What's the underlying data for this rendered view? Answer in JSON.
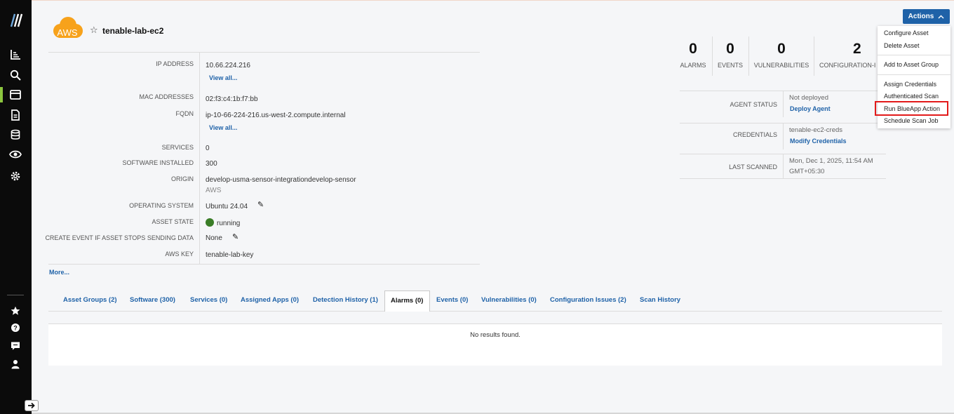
{
  "asset": {
    "badge_text": "AWS",
    "title": "tenable-lab-ec2"
  },
  "details": [
    {
      "label": "IP ADDRESS",
      "value": "10.66.224.216",
      "link": "View all..."
    },
    {
      "label": "MAC ADDRESSES",
      "value": "02:f3:c4:1b:f7:bb"
    },
    {
      "label": "FQDN",
      "value": "ip-10-66-224-216.us-west-2.compute.internal",
      "link": "View all..."
    },
    {
      "label": "SERVICES",
      "value": "0"
    },
    {
      "label": "SOFTWARE INSTALLED",
      "value": "300"
    },
    {
      "label": "ORIGIN",
      "value": "develop-usma-sensor-integrationdevelop-sensor",
      "sub": "AWS"
    },
    {
      "label": "OPERATING SYSTEM",
      "value": "Ubuntu 24.04"
    },
    {
      "label": "ASSET STATE",
      "value": "running"
    },
    {
      "label": "CREATE EVENT IF ASSET STOPS SENDING DATA",
      "value": "None"
    },
    {
      "label": "AWS KEY",
      "value": "tenable-lab-key"
    }
  ],
  "more_link": "More...",
  "stats": [
    {
      "num": "0",
      "label": "ALARMS"
    },
    {
      "num": "0",
      "label": "EVENTS"
    },
    {
      "num": "0",
      "label": "VULNERABILITIES"
    },
    {
      "num": "2",
      "label": "CONFIGURATION-I"
    }
  ],
  "info": {
    "agent_status": {
      "label": "AGENT STATUS",
      "value": "Not deployed",
      "link": "Deploy Agent"
    },
    "credentials": {
      "label": "CREDENTIALS",
      "value": "tenable-ec2-creds",
      "link": "Modify Credentials"
    },
    "last_scanned": {
      "label": "LAST SCANNED",
      "line1": "Mon, Dec 1, 2025, 11:54 AM",
      "line2": "GMT+05:30"
    }
  },
  "actions": {
    "label": "Actions",
    "items": [
      "Configure Asset",
      "Delete Asset",
      "Add to Asset Group",
      "Assign Credentials",
      "Authenticated Scan",
      "Run BlueApp Action",
      "Schedule Scan Job"
    ]
  },
  "tabs": [
    "Asset Groups (2)",
    "Software (300)",
    "Services (0)",
    "Assigned Apps (0)",
    "Detection History (1)",
    "Alarms (0)",
    "Events (0)",
    "Vulnerabilities (0)",
    "Configuration Issues (2)",
    "Scan History"
  ],
  "results_text": "No results found.",
  "colors": {
    "accent": "#1f62a8",
    "sidebar": "#0b0b0b",
    "active": "#8cc63f",
    "aws_orange": "#f7a21b",
    "highlight": "#e21a1a"
  }
}
